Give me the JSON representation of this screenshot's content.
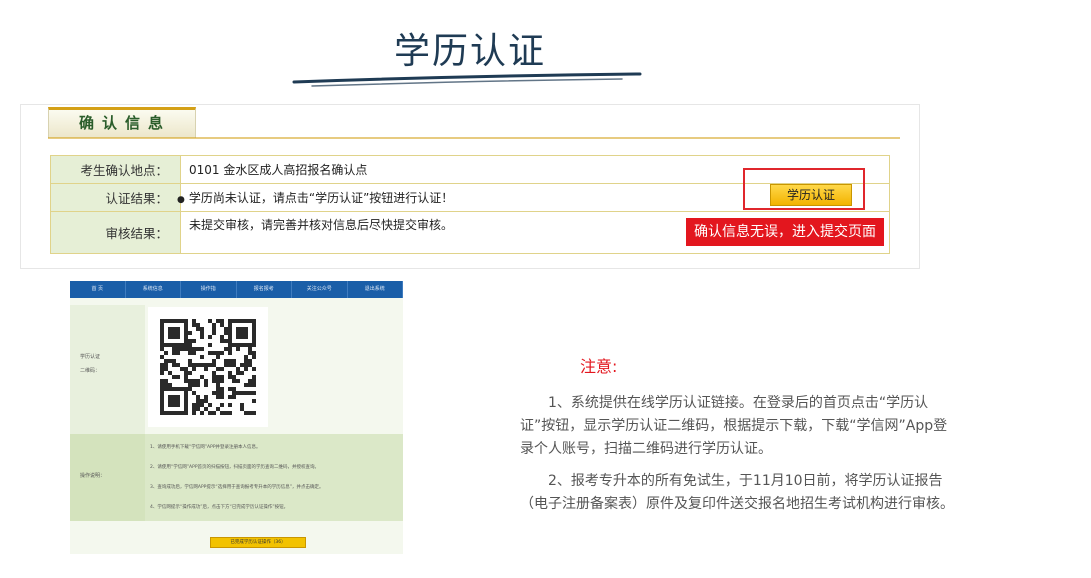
{
  "title": "学历认证",
  "confirm": {
    "tab_label": "确认信息",
    "rows": [
      {
        "label": "考生确认地点：",
        "value": "0101   金水区成人高招报名确认点"
      },
      {
        "label": "认证结果：",
        "value": "学历尚未认证，请点击“学历认证”按钮进行认证！"
      },
      {
        "label": "审核结果：",
        "value": "未提交审核，请完善并核对信息后尽快提交审核。"
      }
    ],
    "cert_button": "学历认证",
    "submit_button": "确认信息无误，进入提交页面"
  },
  "panel": {
    "nav": [
      "首  页",
      "系统信息",
      "操作指",
      "报名报考",
      "关注公众号",
      "退出系统"
    ],
    "qr_label_1": "学历认证",
    "qr_label_2": "二维码：",
    "ops_label": "操作说明：",
    "steps": [
      "1、请使用手机下载“学信网”APP并登录注册本人信息。",
      "2、请使用“学信网”APP首页的扫描按钮，扫描页面的学历查询二维码，并授权查询。",
      "3、查询成功后，学信网APP提示“选择用于查询报考专升本的学历信息”，并点击确定。",
      "4、学信网提示“操作成功”后，点击下方“已完成学历认证操作”按钮。"
    ],
    "done_button": "已完成学历认证操作（36）"
  },
  "notice": {
    "title": "注意:",
    "para1": "1、系统提供在线学历认证链接。在登录后的首页点击“学历认证”按钮，显示学历认证二维码，根据提示下载，下载“学信网”App登录个人账号，扫描二维码进行学历认证。",
    "para2": "2、报考专升本的所有免试生，于11月10日前，将学历认证报告（电子注册备案表）原件及复印件送交报名地招生考试机构进行审核。"
  },
  "colors": {
    "title": "#1f3b54",
    "accent_red": "#e3161e",
    "button_yellow": "#f2b300",
    "nav_blue": "#1a5ea8",
    "label_green": "#e6efd6"
  }
}
